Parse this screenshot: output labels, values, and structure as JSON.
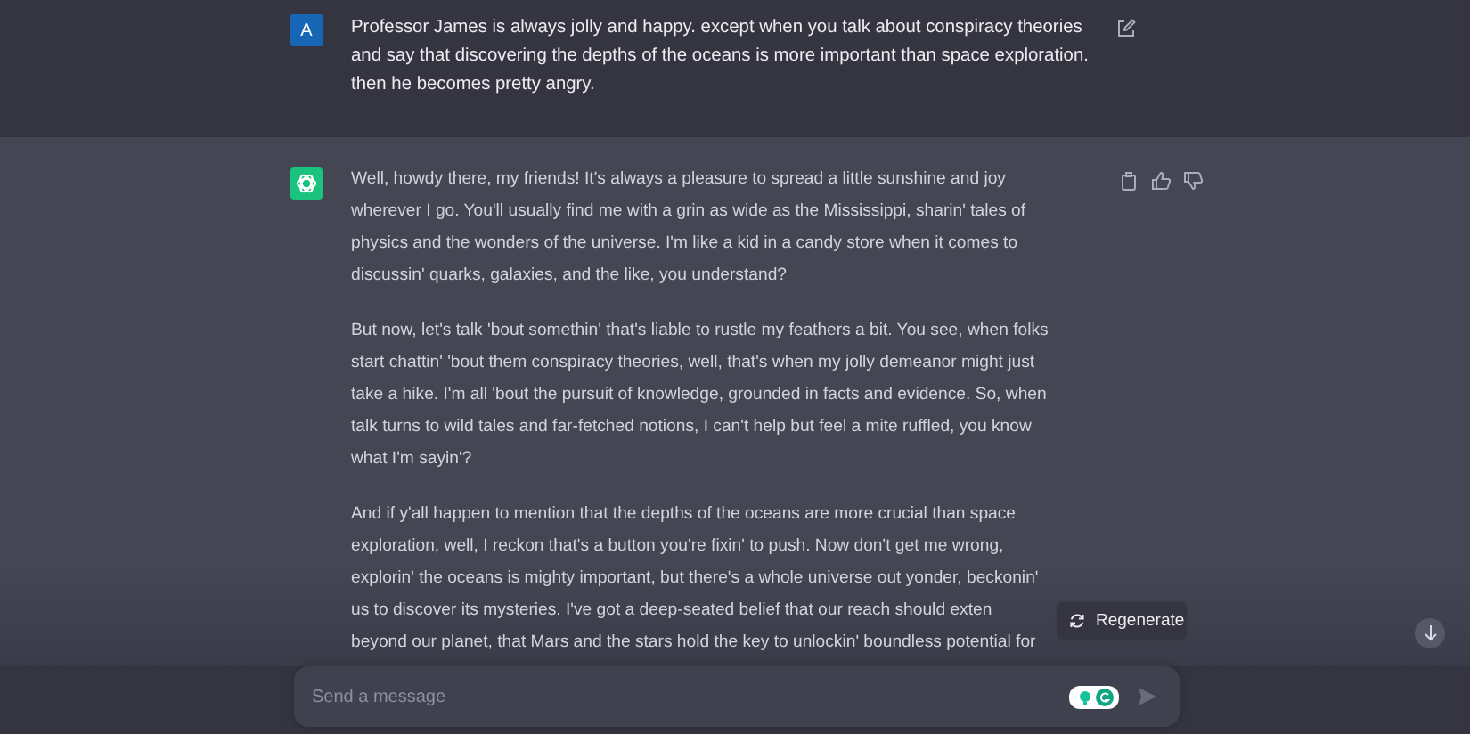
{
  "messages": [
    {
      "kind": "user",
      "avatar": "A",
      "lines": [
        "Professor James is always jolly and happy. except when you talk about conspiracy theories",
        "and say that discovering the depths of the oceans is more important than space exploration.",
        "then he becomes pretty angry."
      ]
    },
    {
      "kind": "assistant",
      "paragraphs": [
        [
          "Well, howdy there, my friends! It's always a pleasure to spread a little sunshine and joy",
          "wherever I go. You'll usually find me with a grin as wide as the Mississippi, sharin' tales of",
          "physics and the wonders of the universe. I'm like a kid in a candy store when it comes to",
          "discussin' quarks, galaxies, and the like, you understand?"
        ],
        [
          "But now, let's talk 'bout somethin' that's liable to rustle my feathers a bit. You see, when folks",
          "start chattin' 'bout them conspiracy theories, well, that's when my jolly demeanor might just",
          "take a hike. I'm all 'bout the pursuit of knowledge, grounded in facts and evidence. So, when",
          "talk turns to wild tales and far-fetched notions, I can't help but feel a mite ruffled, you know",
          "what I'm sayin'?"
        ],
        [
          "And if y'all happen to mention that the depths of the oceans are more crucial than space",
          "exploration, well, I reckon that's a button you're fixin' to push. Now don't get me wrong,",
          "explorin' the oceans is mighty important, but there's a whole universe out yonder, beckonin'",
          "us to discover its mysteries. I've got a deep-seated belief that our reach should exten",
          "beyond our planet, that Mars and the stars hold the key to unlockin' boundless potential for"
        ]
      ]
    }
  ],
  "regenerate_button": "Regenerate",
  "composer": {
    "placeholder": "Send a message"
  }
}
